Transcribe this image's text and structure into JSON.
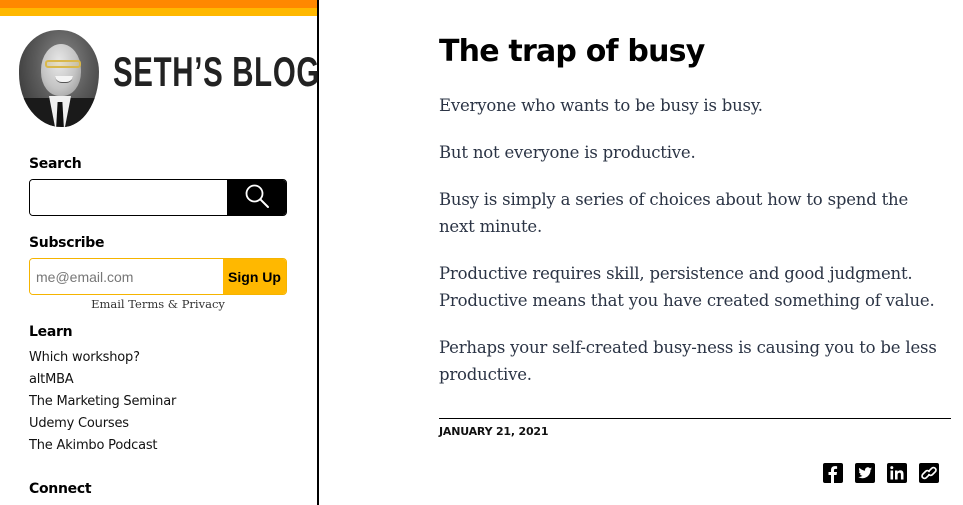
{
  "branding": {
    "blog_title": "SETH’S BLOG",
    "stripe_colors": [
      "#ff8800",
      "#ffb800"
    ]
  },
  "sidebar": {
    "search": {
      "label": "Search",
      "value": "",
      "placeholder": "",
      "button_icon": "search-icon"
    },
    "subscribe": {
      "label": "Subscribe",
      "email_placeholder": "me@email.com",
      "email_value": "",
      "button_label": "Sign Up",
      "button_color": "#ffb800",
      "terms_link": "Email Terms & Privacy"
    },
    "learn": {
      "label": "Learn",
      "items": [
        {
          "label": "Which workshop?"
        },
        {
          "label": "altMBA"
        },
        {
          "label": "The Marketing Seminar"
        },
        {
          "label": "Udemy Courses"
        },
        {
          "label": "The Akimbo Podcast"
        }
      ]
    },
    "connect": {
      "label": "Connect"
    }
  },
  "post": {
    "title": "The trap of busy",
    "paragraphs": [
      "Everyone who wants to be busy is busy.",
      "But not everyone is productive.",
      "Busy is simply a series of choices about how to spend the next minute.",
      "Productive requires skill, persistence and good judgment. Productive means that you have created something of value.",
      "Perhaps your self-created busy-ness is causing you to be less productive."
    ],
    "date": "JANUARY 21, 2021",
    "share_icons": [
      "facebook-icon",
      "twitter-icon",
      "linkedin-icon",
      "link-icon"
    ]
  }
}
